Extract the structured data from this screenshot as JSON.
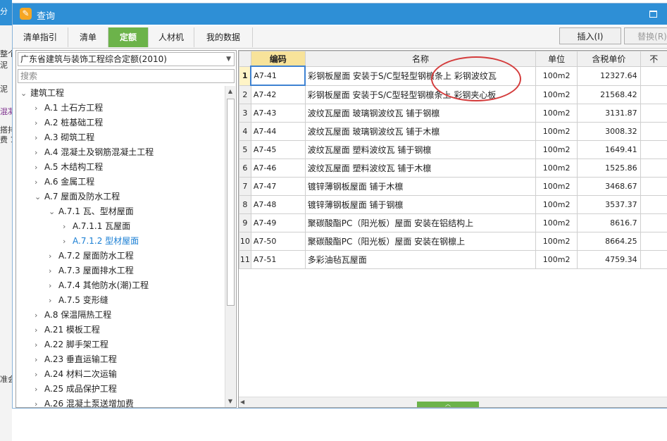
{
  "background": {
    "fragments": [
      "分",
      "整个",
      "泥",
      "泥",
      "混凝",
      "搭排",
      "费 1",
      "准会"
    ]
  },
  "window": {
    "title": "查询",
    "title_icon": "magnifier-app-icon"
  },
  "tabs": [
    {
      "label": "清单指引",
      "active": false
    },
    {
      "label": "清单",
      "active": false
    },
    {
      "label": "定额",
      "active": true
    },
    {
      "label": "人材机",
      "active": false
    },
    {
      "label": "我的数据",
      "active": false
    }
  ],
  "toolbar": {
    "insert_label": "插入(I)",
    "replace_label": "替换(R)"
  },
  "left": {
    "library": "广东省建筑与装饰工程综合定额(2010)",
    "search_placeholder": "搜索",
    "tree": [
      {
        "label": "建筑工程",
        "level": 0,
        "expanded": true
      },
      {
        "label": "A.1 土石方工程",
        "level": 1,
        "expanded": false
      },
      {
        "label": "A.2 桩基础工程",
        "level": 1,
        "expanded": false
      },
      {
        "label": "A.3 砌筑工程",
        "level": 1,
        "expanded": false
      },
      {
        "label": "A.4 混凝土及钢筋混凝土工程",
        "level": 1,
        "expanded": false
      },
      {
        "label": "A.5 木结构工程",
        "level": 1,
        "expanded": false
      },
      {
        "label": "A.6 金属工程",
        "level": 1,
        "expanded": false
      },
      {
        "label": "A.7 屋面及防水工程",
        "level": 1,
        "expanded": true
      },
      {
        "label": "A.7.1 瓦、型材屋面",
        "level": 2,
        "expanded": true
      },
      {
        "label": "A.7.1.1 瓦屋面",
        "level": 3,
        "expanded": false
      },
      {
        "label": "A.7.1.2 型材屋面",
        "level": 3,
        "expanded": false,
        "selected": true
      },
      {
        "label": "A.7.2 屋面防水工程",
        "level": 2,
        "expanded": false
      },
      {
        "label": "A.7.3 屋面排水工程",
        "level": 2,
        "expanded": false
      },
      {
        "label": "A.7.4 其他防水(潮)工程",
        "level": 2,
        "expanded": false
      },
      {
        "label": "A.7.5 变形缝",
        "level": 2,
        "expanded": false
      },
      {
        "label": "A.8 保温隔热工程",
        "level": 1,
        "expanded": false
      },
      {
        "label": "A.21 模板工程",
        "level": 1,
        "expanded": false
      },
      {
        "label": "A.22 脚手架工程",
        "level": 1,
        "expanded": false
      },
      {
        "label": "A.23 垂直运输工程",
        "level": 1,
        "expanded": false
      },
      {
        "label": "A.24 材料二次运输",
        "level": 1,
        "expanded": false
      },
      {
        "label": "A.25 成品保护工程",
        "level": 1,
        "expanded": false
      },
      {
        "label": "A.26 混凝土泵送增加费",
        "level": 1,
        "expanded": false
      }
    ]
  },
  "table": {
    "columns": [
      "",
      "编码",
      "名称",
      "单位",
      "含税单价",
      "不"
    ],
    "rows": [
      {
        "no": "1",
        "code": "A7-41",
        "name": "彩钢板屋面 安装于S/C型轻型钢檩条上 彩钢波纹瓦",
        "unit": "100m2",
        "price": "12327.64"
      },
      {
        "no": "2",
        "code": "A7-42",
        "name": "彩钢板屋面 安装于S/C型轻型钢檩条上 彩钢夹心板",
        "unit": "100m2",
        "price": "21568.42"
      },
      {
        "no": "3",
        "code": "A7-43",
        "name": "波纹瓦屋面 玻璃钢波纹瓦 铺于钢檩",
        "unit": "100m2",
        "price": "3131.87"
      },
      {
        "no": "4",
        "code": "A7-44",
        "name": "波纹瓦屋面 玻璃钢波纹瓦 铺于木檩",
        "unit": "100m2",
        "price": "3008.32"
      },
      {
        "no": "5",
        "code": "A7-45",
        "name": "波纹瓦屋面 塑料波纹瓦 铺于钢檩",
        "unit": "100m2",
        "price": "1649.41"
      },
      {
        "no": "6",
        "code": "A7-46",
        "name": "波纹瓦屋面 塑料波纹瓦 铺于木檩",
        "unit": "100m2",
        "price": "1525.86"
      },
      {
        "no": "7",
        "code": "A7-47",
        "name": "镀锌薄钢板屋面 铺于木檩",
        "unit": "100m2",
        "price": "3468.67"
      },
      {
        "no": "8",
        "code": "A7-48",
        "name": "镀锌薄钢板屋面 铺于钢檩",
        "unit": "100m2",
        "price": "3537.37"
      },
      {
        "no": "9",
        "code": "A7-49",
        "name": "聚碳酸酯PC（阳光板）屋面 安装在铝结构上",
        "unit": "100m2",
        "price": "8616.7"
      },
      {
        "no": "10",
        "code": "A7-50",
        "name": "聚碳酸酯PC（阳光板）屋面 安装在钢檩上",
        "unit": "100m2",
        "price": "8664.25"
      },
      {
        "no": "11",
        "code": "A7-51",
        "name": "多彩油毡瓦屋面",
        "unit": "100m2",
        "price": "4759.34"
      }
    ]
  },
  "colors": {
    "titlebar": "#2e8fd6",
    "active_tab": "#6cb34a",
    "header_highlight": "#f8e39a",
    "selected_tree": "#1a7fd4",
    "annotation": "#d43c3c"
  }
}
